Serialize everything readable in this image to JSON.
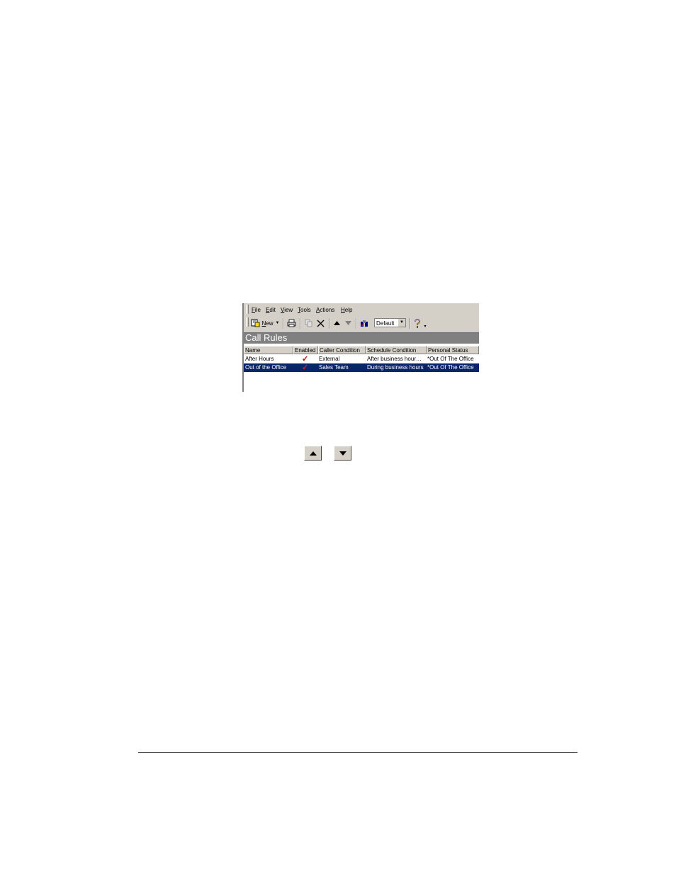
{
  "menu": [
    {
      "key": "F",
      "rest": "ile"
    },
    {
      "key": "E",
      "rest": "dit"
    },
    {
      "key": "V",
      "rest": "iew"
    },
    {
      "key": "T",
      "rest": "ools"
    },
    {
      "key": "A",
      "rest": "ctions"
    },
    {
      "key": "H",
      "rest": "elp"
    }
  ],
  "toolbar": {
    "new_key": "N",
    "new_rest": "ew",
    "view_combo": "Default"
  },
  "pane_title": "Call Rules",
  "columns": [
    "Name",
    "Enabled",
    "Caller Condition",
    "Schedule Condition",
    "Personal Status"
  ],
  "rows": [
    {
      "name": "After Hours",
      "enabled": "✓",
      "caller": "External",
      "schedule": "After business hour…",
      "status": "*Out Of The Office",
      "selected": false
    },
    {
      "name": "Out of the Office",
      "enabled": "✓",
      "caller": "Sales Team",
      "schedule": "During business hours",
      "status": "*Out Of The Office",
      "selected": true
    }
  ],
  "icons": {
    "move_up": "triangle-up-icon",
    "move_down": "triangle-down-icon"
  },
  "colors": {
    "chrome": "#d4d0c8",
    "title_bar": "#808080",
    "selection": "#0a246a",
    "check": "#c00000"
  }
}
